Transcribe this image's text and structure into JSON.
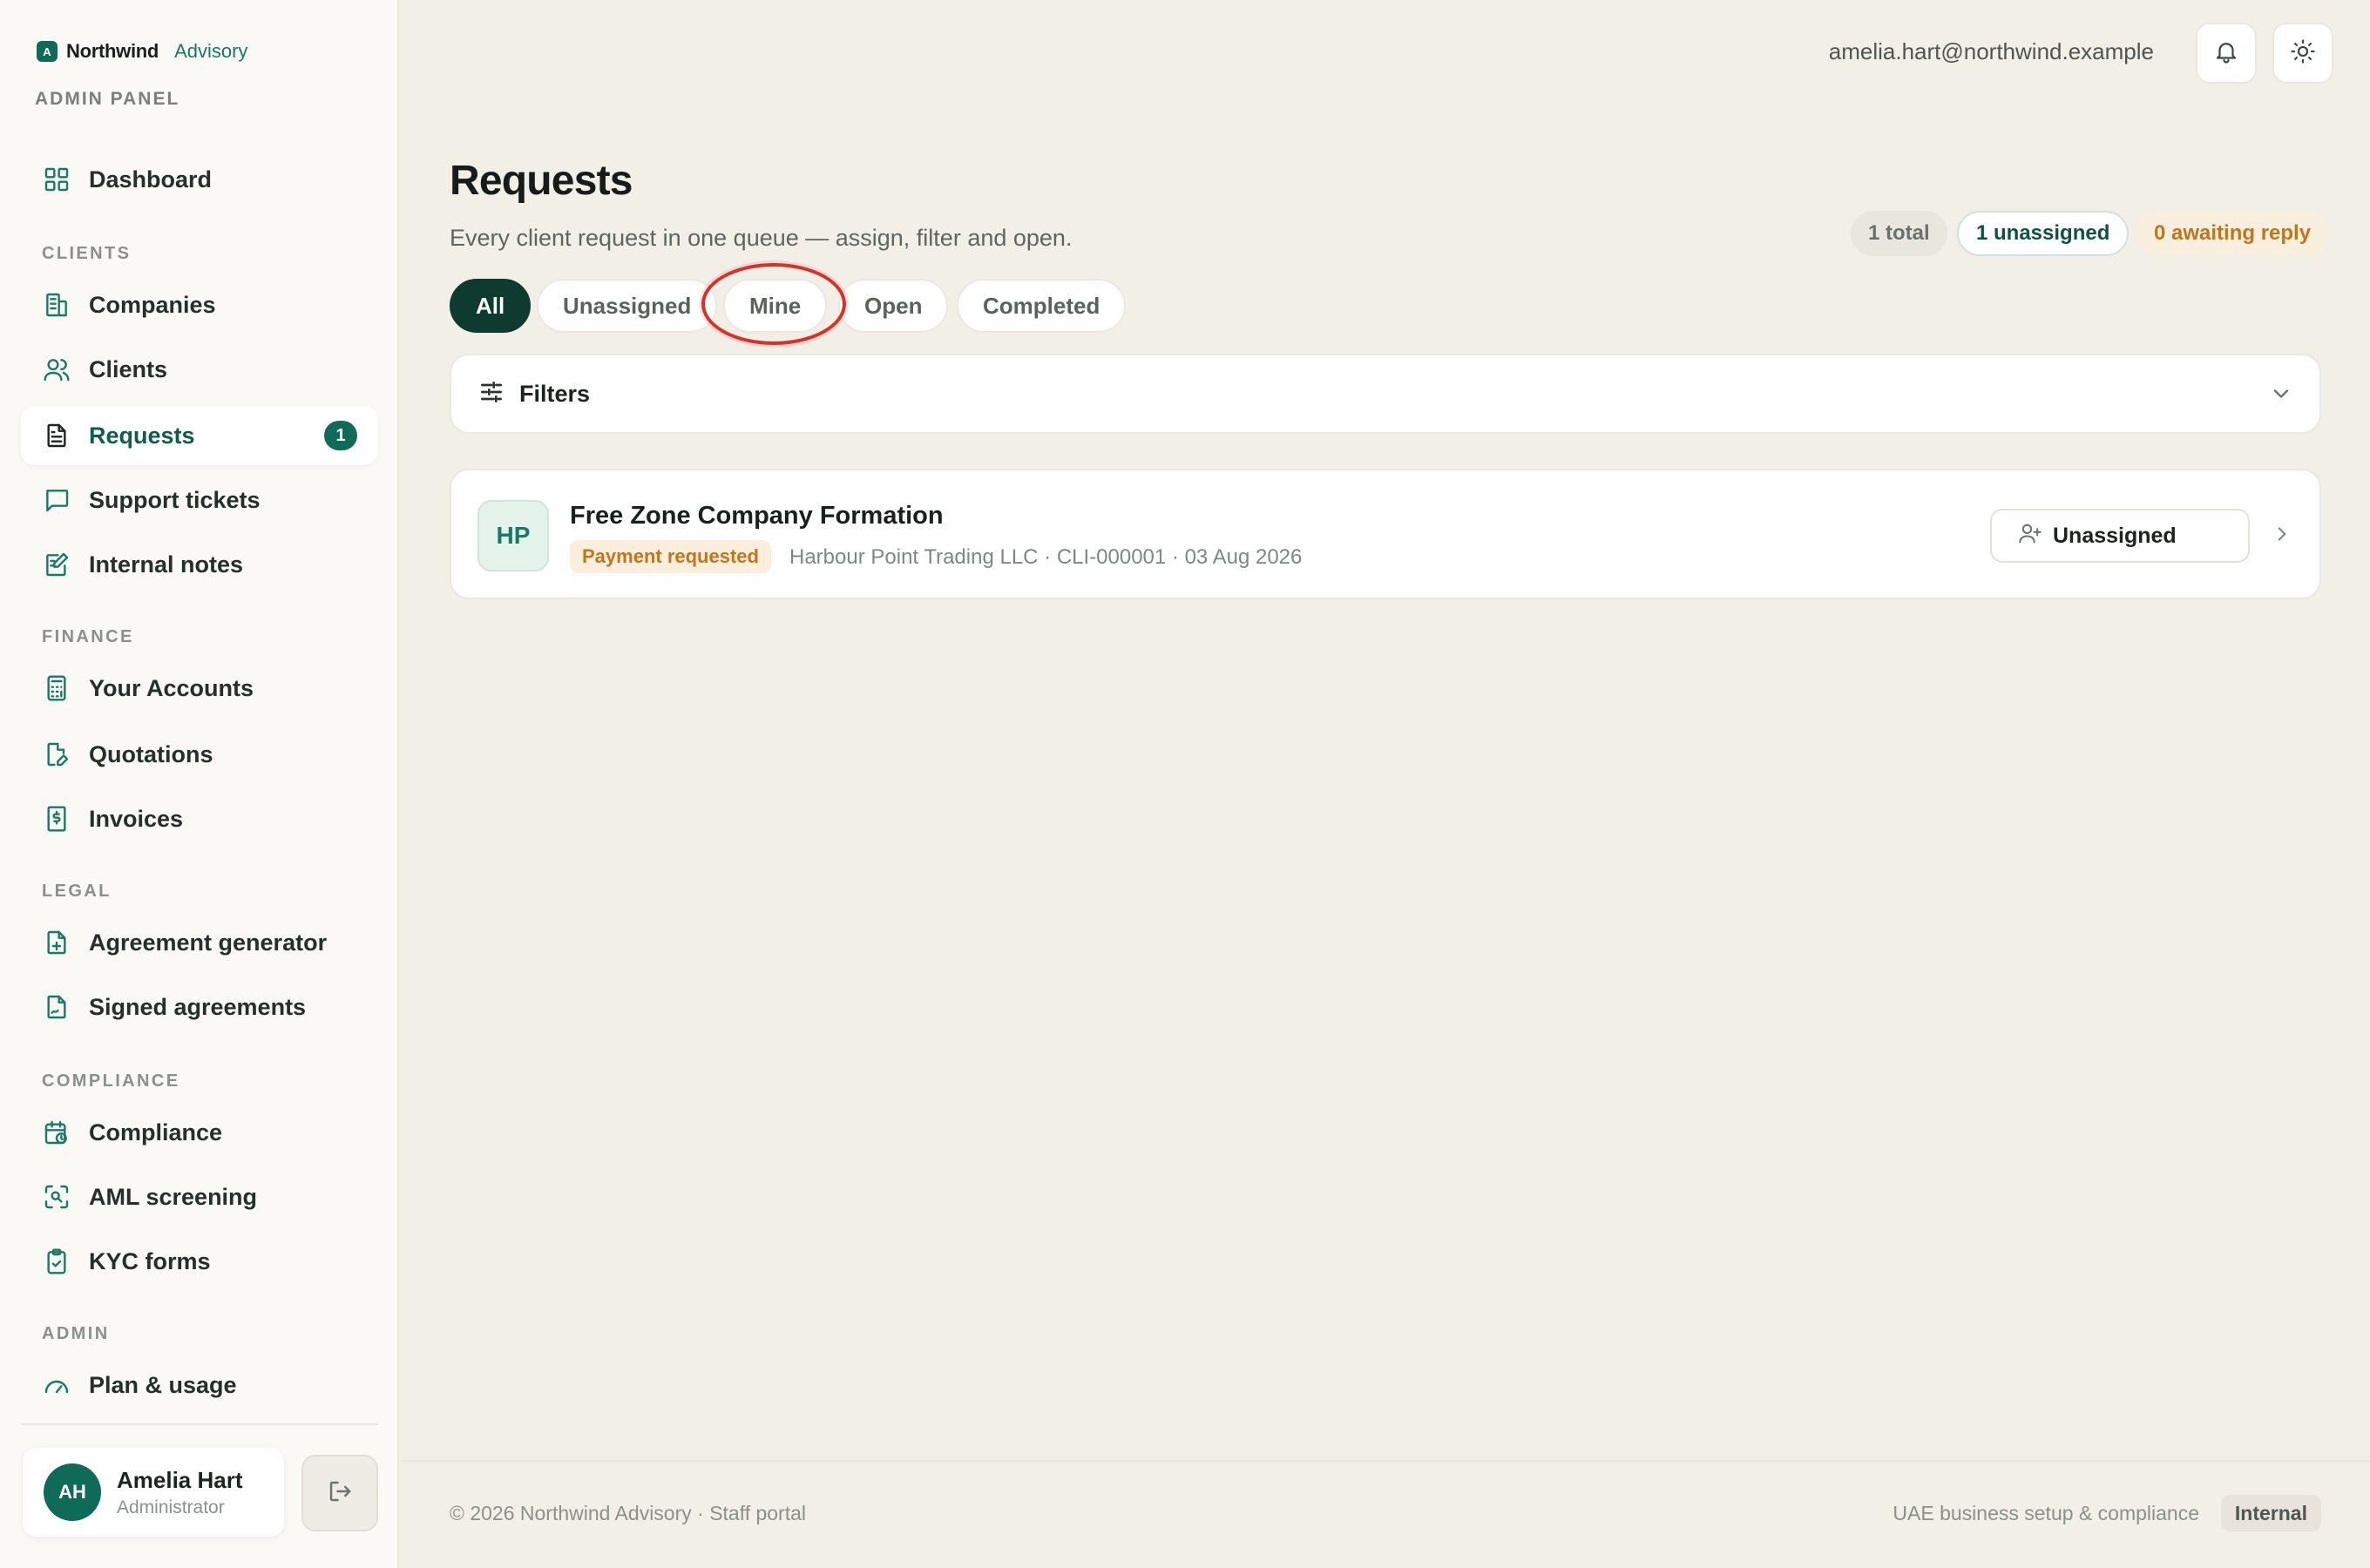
{
  "brand": {
    "logo_letter": "A",
    "name": "Northwind",
    "sub": "Advisory",
    "panel": "ADMIN PANEL"
  },
  "sidebar": {
    "dashboard": "Dashboard",
    "sections": {
      "clients": "CLIENTS",
      "finance": "FINANCE",
      "legal": "LEGAL",
      "compliance": "COMPLIANCE",
      "admin": "ADMIN"
    },
    "items": {
      "companies": "Companies",
      "clients": "Clients",
      "requests": "Requests",
      "requests_badge": "1",
      "support": "Support tickets",
      "notes": "Internal notes",
      "accounts": "Your Accounts",
      "quotations": "Quotations",
      "invoices": "Invoices",
      "agreement_gen": "Agreement generator",
      "signed": "Signed agreements",
      "compliance": "Compliance",
      "aml": "AML screening",
      "kyc": "KYC forms",
      "plan": "Plan & usage"
    },
    "user": {
      "initials": "AH",
      "name": "Amelia Hart",
      "role": "Administrator"
    }
  },
  "topbar": {
    "email": "amelia.hart@northwind.example"
  },
  "main": {
    "title": "Requests",
    "subtitle": "Every client request in one queue — assign, filter and open.",
    "stats": {
      "total": "1 total",
      "unassigned": "1 unassigned",
      "awaiting": "0 awaiting reply"
    },
    "tabs": {
      "all": "All",
      "unassigned": "Unassigned",
      "mine": "Mine",
      "open": "Open",
      "completed": "Completed"
    },
    "filters_label": "Filters",
    "request": {
      "initials": "HP",
      "title": "Free Zone Company Formation",
      "status": "Payment requested",
      "meta": "Harbour Point Trading LLC · CLI-000001 · 03 Aug 2026",
      "assignee": "Unassigned"
    }
  },
  "footer": {
    "left": "© 2026 Northwind Advisory · Staff portal",
    "right": "UAE business setup & compliance",
    "badge": "Internal"
  },
  "colors": {
    "accent": "#0f6b57",
    "dark_tab": "#0d3b30",
    "warning": "#c0771b",
    "highlight": "#d9302a"
  }
}
